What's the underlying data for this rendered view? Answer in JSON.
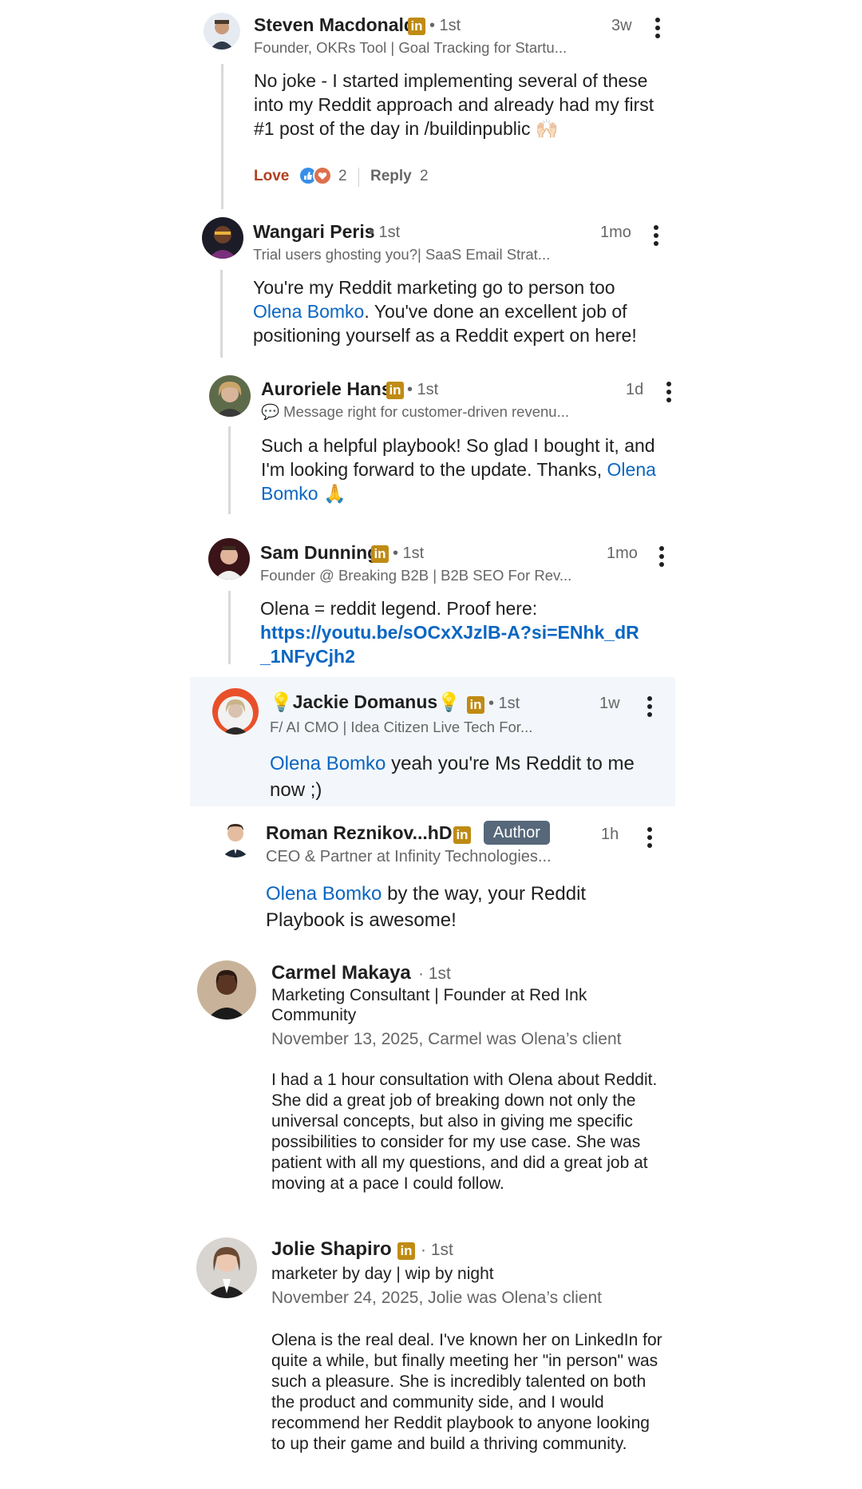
{
  "comments": [
    {
      "name": "Steven Macdonald",
      "degree": "• 1st",
      "time": "3w",
      "headline": "Founder, OKRs Tool | Goal Tracking for Startu...",
      "body": "No joke - I started implementing several of these into my Reddit approach and already had my first #1 post of the day in /buildinpublic 🙌🏻",
      "reaction_label": "Love",
      "reaction_count": "2",
      "reply_label": "Reply",
      "reply_count": "2"
    },
    {
      "name": "Wangari Peris",
      "degree": "• 1st",
      "time": "1mo",
      "headline": "Trial users ghosting you?| SaaS Email Strat...",
      "body_pre": "You're my Reddit marketing go to person too ",
      "mention": "Olena Bomko",
      "body_post": ". You've done an excellent job of positioning yourself as a Reddit expert on here!"
    },
    {
      "name": "Auroriele Hans",
      "degree": "• 1st",
      "time": "1d",
      "headline": "💬 Message right for customer-driven revenu...",
      "body_pre": "Such a helpful playbook! So glad I bought it, and I'm looking forward to the update. Thanks, ",
      "mention": "Olena Bomko",
      "body_post": " 🙏"
    },
    {
      "name": "Sam Dunning",
      "degree": "• 1st",
      "time": "1mo",
      "headline": "Founder @ Breaking B2B | B2B SEO For Rev...",
      "body_pre": "Olena = reddit legend. Proof here:",
      "link_line1": "https://youtu.be/sOCxXJzlB-A?si=ENhk_dR",
      "link_line2": "_1NFyCjh2"
    },
    {
      "name": "💡Jackie Domanus💡",
      "degree": "• 1st",
      "time": "1w",
      "headline": "F/ AI CMO | Idea Citizen Live Tech For...",
      "mention": "Olena Bomko",
      "body_post": " yeah you're Ms Reddit to me now ;)"
    },
    {
      "name": "Roman Reznikov...hD",
      "author_badge": "Author",
      "time": "1h",
      "headline": "CEO & Partner at Infinity Technologies...",
      "mention": "Olena Bomko",
      "body_post": " by the way, your Reddit Playbook is awesome!"
    }
  ],
  "recommendations": [
    {
      "name": "Carmel Makaya",
      "degree": "· 1st",
      "headline": "Marketing Consultant | Founder at Red Ink Community",
      "date": "November 13, 2025, Carmel was Olena’s client",
      "body": "I had a 1 hour consultation with Olena about Reddit. She did a great job of breaking down not only the universal concepts, but also in giving me specific possibilities to consider for my use case. She was patient with all my questions, and did a great job at moving at a pace I could follow."
    },
    {
      "name": "Jolie Shapiro",
      "degree": "· 1st",
      "headline": "marketer by day | wip by night",
      "date": "November 24, 2025, Jolie was Olena’s client",
      "body": "Olena is the real deal. I've known her on LinkedIn for quite a while, but finally meeting her \"in person\" was such a pleasure. She is incredibly talented on both the product and community side, and I would recommend her Reddit playbook to anyone looking to up their game and build a thriving community."
    }
  ],
  "icons": {
    "linkedin_badge": "in",
    "more": "more-vertical-icon"
  },
  "colors": {
    "mention": "#0a66c2",
    "love": "#b24020",
    "badge": "#c08b14",
    "author_badge": "#56687a"
  }
}
